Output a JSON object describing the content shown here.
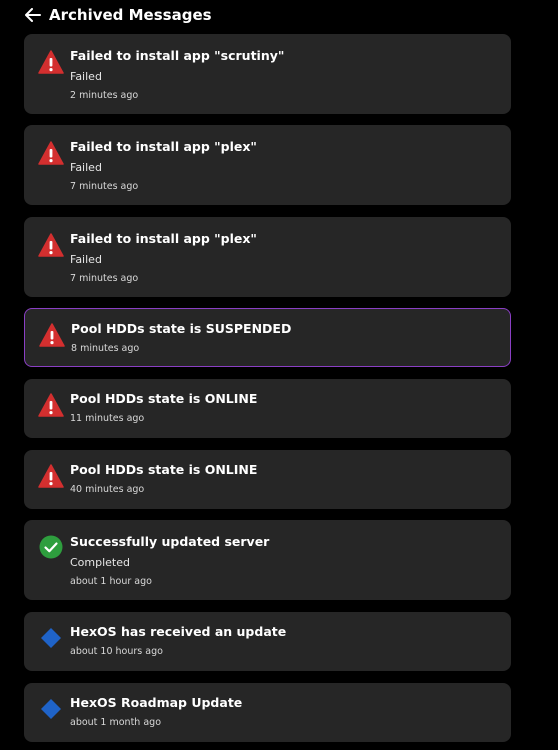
{
  "header": {
    "title": "Archived Messages",
    "back_icon": "arrow-left-icon"
  },
  "colors": {
    "error": "#d32f2f",
    "success": "#2e9e3e",
    "info": "#1f63c8",
    "card_bg": "#262626",
    "active_border": "#8a3fc4"
  },
  "messages": [
    {
      "title": "Failed to install app \"scrutiny\"",
      "status": "Failed",
      "time": "2 minutes ago",
      "icon": "warning-icon"
    },
    {
      "title": "Failed to install app \"plex\"",
      "status": "Failed",
      "time": "7 minutes ago",
      "icon": "warning-icon"
    },
    {
      "title": "Failed to install app \"plex\"",
      "status": "Failed",
      "time": "7 minutes ago",
      "icon": "warning-icon"
    },
    {
      "title": "Pool HDDs state is SUSPENDED",
      "time": "8 minutes ago",
      "icon": "warning-icon",
      "selected": true
    },
    {
      "title": "Pool HDDs state is ONLINE",
      "time": "11 minutes ago",
      "icon": "warning-icon"
    },
    {
      "title": "Pool HDDs state is ONLINE",
      "time": "40 minutes ago",
      "icon": "warning-icon"
    },
    {
      "title": "Successfully updated server",
      "status": "Completed",
      "time": "about 1 hour ago",
      "icon": "check-circle-icon"
    },
    {
      "title": "HexOS has received an update",
      "time": "about 10 hours ago",
      "icon": "diamond-icon"
    },
    {
      "title": "HexOS Roadmap Update",
      "time": "about 1 month ago",
      "icon": "diamond-icon"
    }
  ]
}
